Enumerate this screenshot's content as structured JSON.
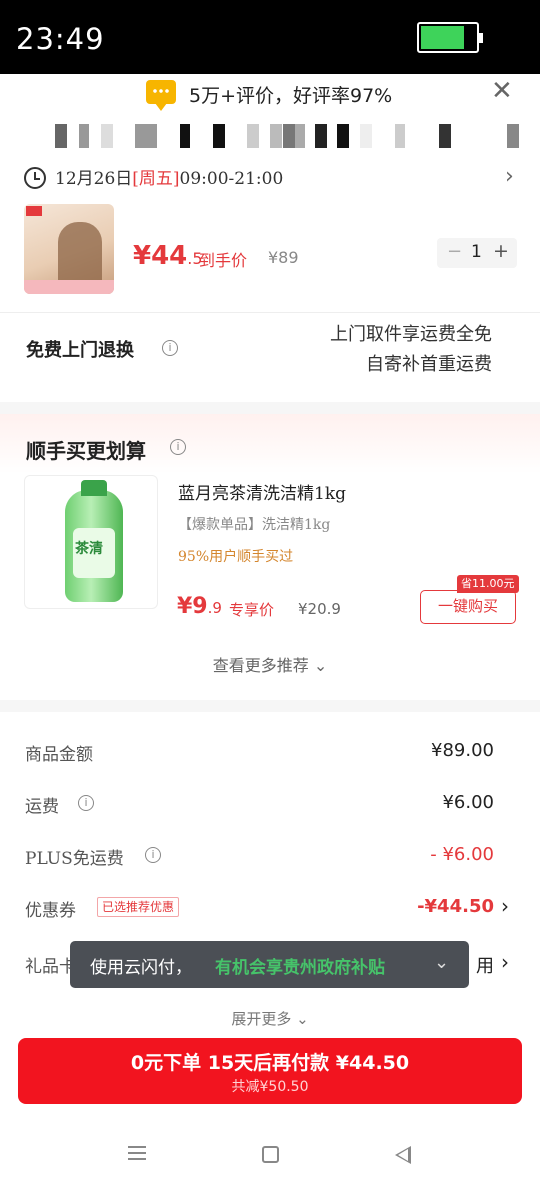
{
  "status_bar": {
    "time": "23:49"
  },
  "rating_banner": {
    "text": "5万+评价，好评率97%"
  },
  "delivery": {
    "date": "12月26日",
    "weekday": "[周五]",
    "hours": "09:00-21:00"
  },
  "product": {
    "price_main": "¥44",
    "price_decimal": ".5",
    "price_label": "到手价",
    "original_price": "¥89",
    "quantity": "1"
  },
  "returns": {
    "title": "免费上门退换",
    "desc_line1": "上门取件享运费全免",
    "desc_line2": "自寄补首重运费"
  },
  "upsell": {
    "title": "顺手买更划算",
    "name": "蓝月亮茶清洗洁精1kg",
    "subtitle": "【爆款单品】洗洁精1kg",
    "buyers": "95%用户顺手买过",
    "price_main": "¥9",
    "price_decimal": ".9",
    "price_label": "专享价",
    "original_price": "¥20.9",
    "save_tag": "省11.00元",
    "buy_label": "一键购买",
    "see_more": "查看更多推荐"
  },
  "summary": {
    "goods_label": "商品金额",
    "goods_value": "¥89.00",
    "shipping_label": "运费",
    "shipping_value": "¥6.00",
    "plus_label": "PLUS免运费",
    "plus_value": "- ¥6.00",
    "coupon_label": "优惠券",
    "coupon_badge": "已选推荐优惠",
    "coupon_value": "-¥44.50",
    "gift_label": "礼品卡",
    "gift_value": "用"
  },
  "toast": {
    "prefix": "使用云闪付，",
    "highlight": "有机会享贵州政府补贴"
  },
  "expand_more": "展开更多",
  "pay_button": {
    "main": "0元下单 15天后再付款 ¥44.50",
    "sub": "共减¥50.50"
  },
  "colors": {
    "accent_red": "#e4393c",
    "pay_red": "#f2141f",
    "toast_green": "#46c36a",
    "battery_green": "#3ed35a"
  }
}
